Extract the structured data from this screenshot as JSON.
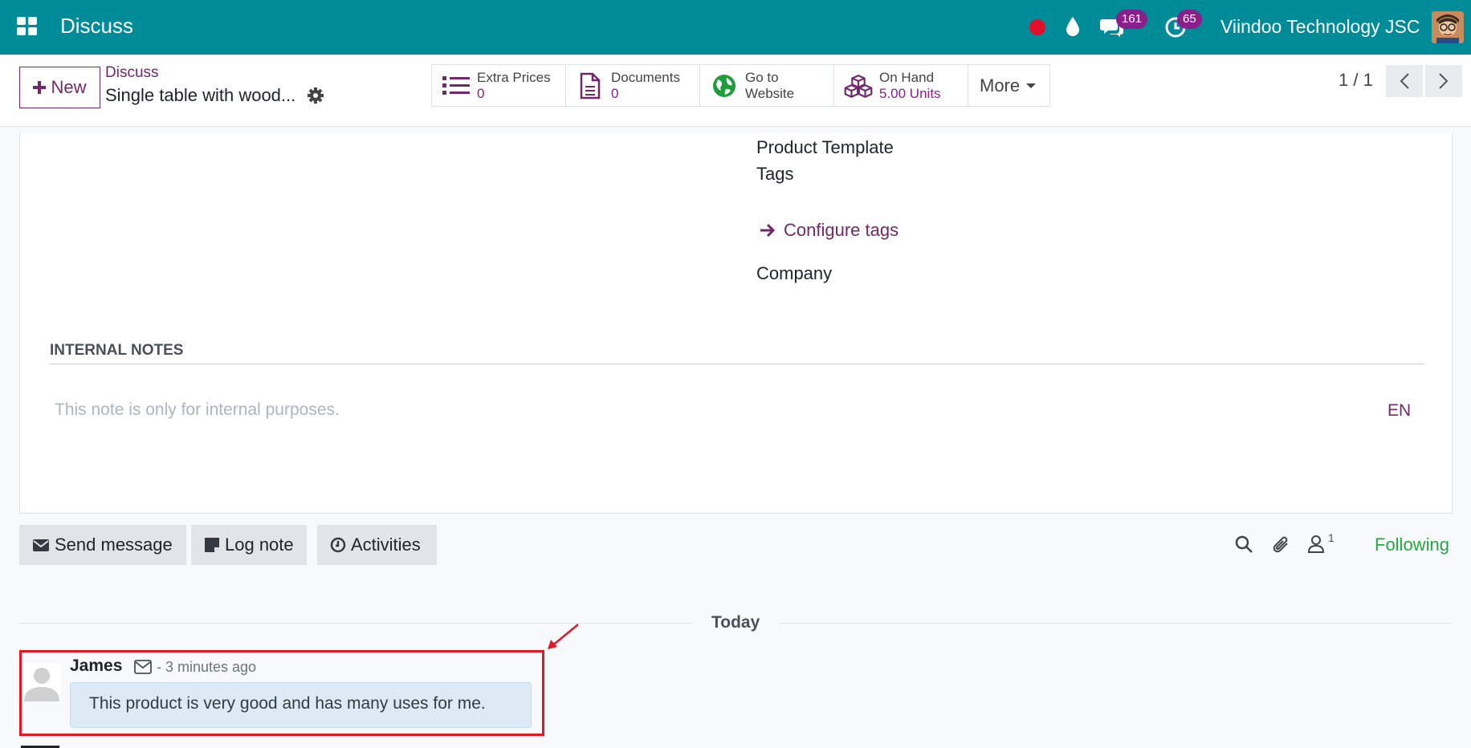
{
  "navbar": {
    "app_title": "Discuss",
    "chat_badge": "161",
    "activity_badge": "65",
    "company": "Viindoo Technology JSC"
  },
  "control": {
    "new_label": "New",
    "breadcrumb": "Discuss",
    "record_name": "Single table with wood...",
    "smart_buttons": [
      {
        "label": "Extra Prices",
        "value": "0",
        "icon": "list-icon"
      },
      {
        "label": "Documents",
        "value": "0",
        "icon": "document-icon"
      },
      {
        "label": "Go to",
        "value": "Website",
        "icon": "globe-icon"
      },
      {
        "label": "On Hand",
        "value": "5.00 Units",
        "icon": "cubes-icon"
      }
    ],
    "more_label": "More",
    "pager": "1 / 1"
  },
  "form": {
    "product_template_label": "Product Template",
    "tags_label": "Tags",
    "configure_tags": "Configure tags",
    "company_label": "Company",
    "internal_notes_title": "INTERNAL NOTES",
    "note_placeholder": "This note is only for internal purposes.",
    "lang": "EN"
  },
  "chatter": {
    "send_message": "Send message",
    "log_note": "Log note",
    "activities": "Activities",
    "follower_count": "1",
    "following": "Following",
    "date_separator": "Today",
    "message": {
      "author": "James",
      "time": "- 3 minutes ago",
      "body": "This product is very good and has many uses for me."
    }
  },
  "colors": {
    "navbar": "#008b99",
    "brand": "#71296b",
    "badge": "#8c1d8c",
    "following": "#28a745",
    "highlight": "#e0192b"
  }
}
